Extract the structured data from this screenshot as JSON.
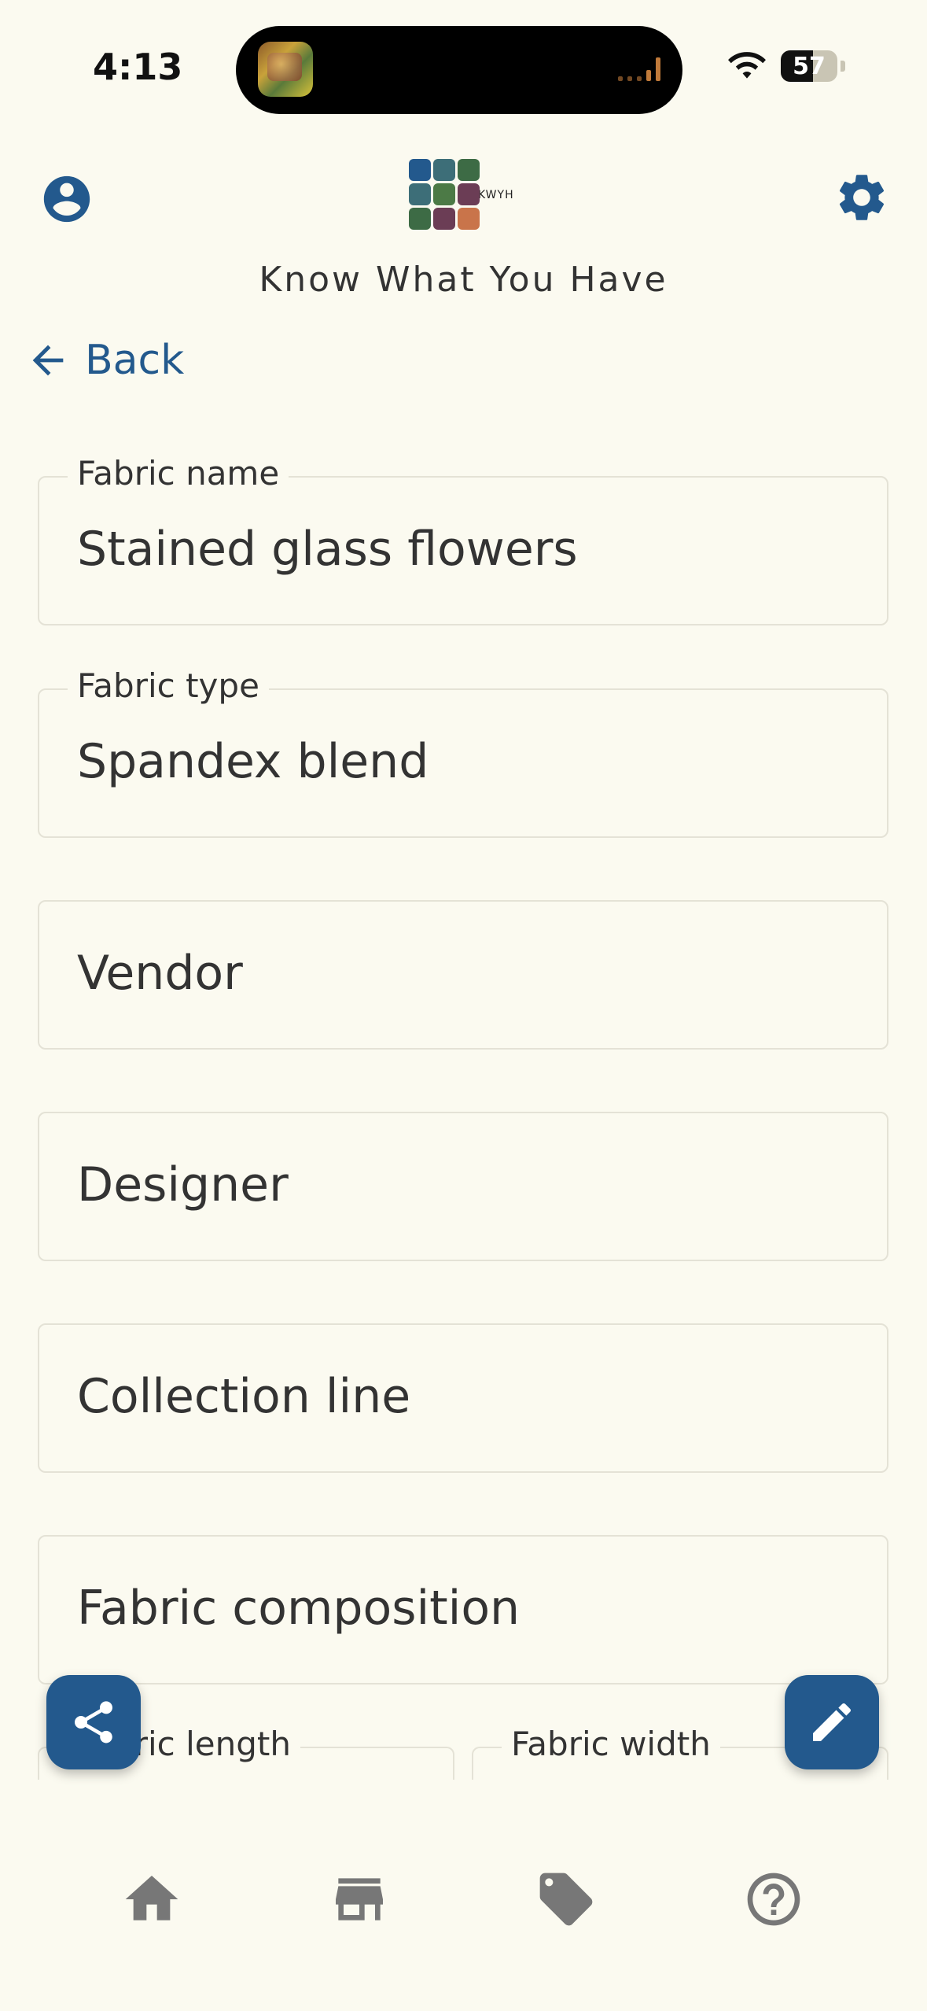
{
  "status_bar": {
    "time": "4:13",
    "battery": "57",
    "battery_percent": 57
  },
  "header": {
    "logo_text": "KWYH",
    "app_title": "Know What You Have",
    "logo_colors": [
      "#23598d",
      "#3d6e78",
      "#3d6b45",
      "#3d6e78",
      "#4c7a46",
      "#6b3d55",
      "#3d6b45",
      "#6b3d55",
      "#c9744a"
    ]
  },
  "nav": {
    "back_label": "Back"
  },
  "fields": {
    "fabric_name": {
      "label": "Fabric name",
      "value": "Stained glass flowers"
    },
    "fabric_type": {
      "label": "Fabric type",
      "value": "Spandex blend"
    },
    "vendor": {
      "placeholder": "Vendor"
    },
    "designer": {
      "placeholder": "Designer"
    },
    "collection_line": {
      "placeholder": "Collection line"
    },
    "fabric_composition": {
      "placeholder": "Fabric composition"
    },
    "fabric_length": {
      "label": "Fabric length"
    },
    "fabric_width": {
      "label": "Fabric width"
    }
  },
  "icons": {
    "account": "account-circle-icon",
    "settings": "gear-icon",
    "back": "arrow-left-icon",
    "share": "share-icon",
    "edit": "pencil-icon",
    "home": "home-icon",
    "store": "store-icon",
    "tag": "tag-icon",
    "help": "help-circle-icon"
  },
  "colors": {
    "accent": "#23598d",
    "background": "#fbfaf0",
    "nav_icon": "#777777"
  }
}
